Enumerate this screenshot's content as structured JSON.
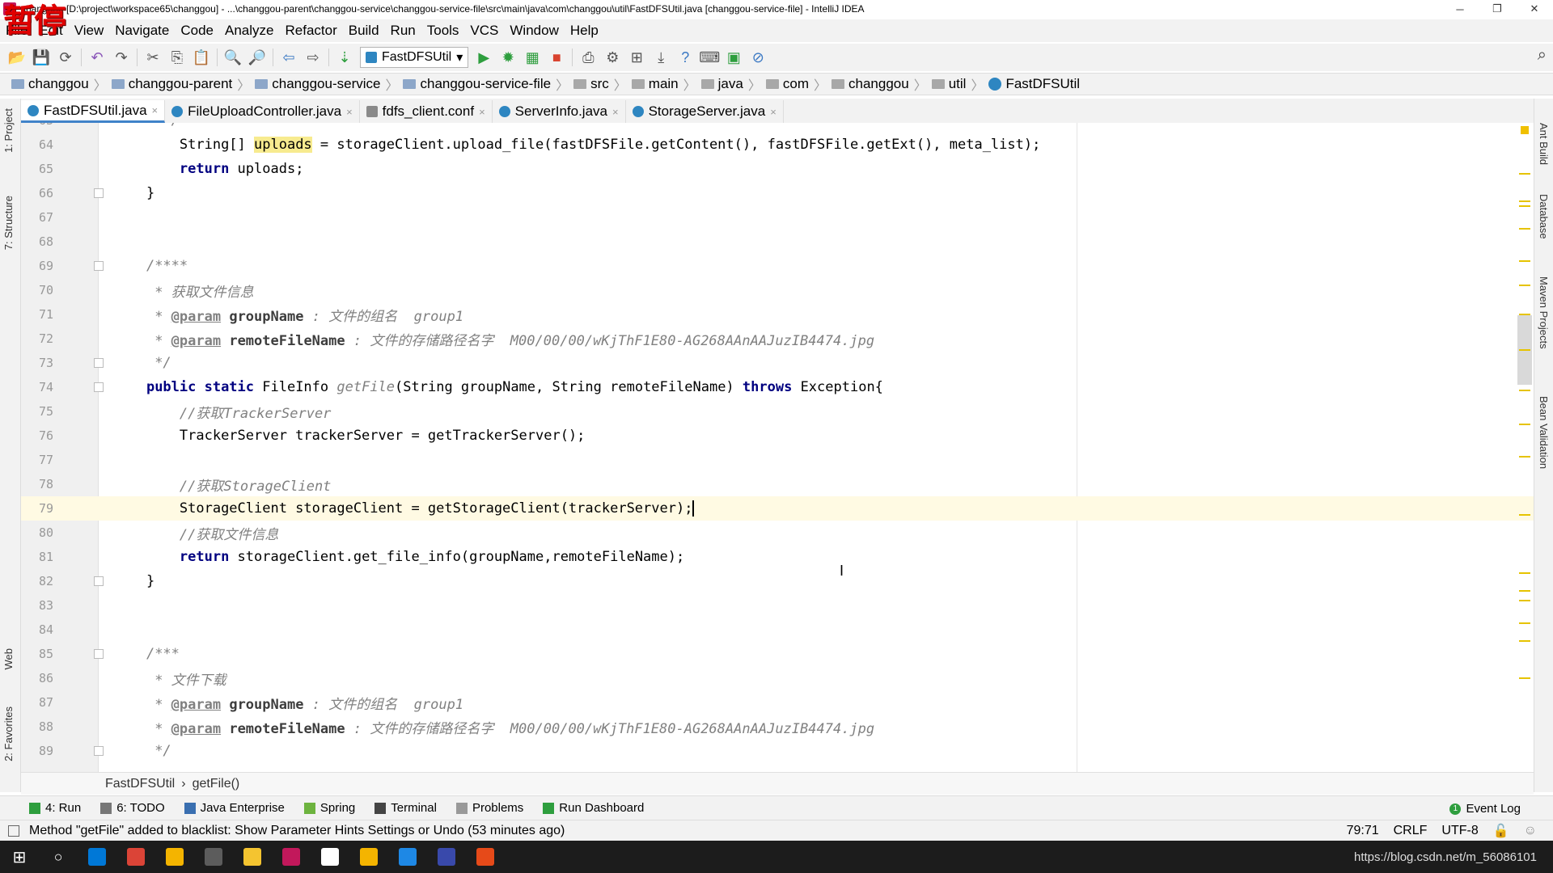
{
  "window": {
    "title": "changgou [D:\\project\\workspace65\\changgou] - ...\\changgou-parent\\changgou-service\\changgou-service-file\\src\\main\\java\\com\\changgou\\util\\FastDFSUtil.java [changgou-service-file] - IntelliJ IDEA",
    "overlay_text": "暂停",
    "minimize": "─",
    "restore": "❐",
    "close": "✕"
  },
  "menu": [
    "File",
    "Edit",
    "View",
    "Navigate",
    "Code",
    "Analyze",
    "Refactor",
    "Build",
    "Run",
    "Tools",
    "VCS",
    "Window",
    "Help"
  ],
  "toolbar": {
    "run_config": "FastDFSUtil",
    "run_config_arrow": "▾"
  },
  "breadcrumbs": [
    "changgou",
    "changgou-parent",
    "changgou-service",
    "changgou-service-file",
    "src",
    "main",
    "java",
    "com",
    "changgou",
    "util",
    "FastDFSUtil"
  ],
  "crumb_sep": "〉",
  "left_tools": [
    "1: Project",
    "7: Structure",
    "Web",
    "2: Favorites"
  ],
  "right_tools": [
    "Ant Build",
    "Database",
    "Maven Projects",
    "Bean Validation"
  ],
  "tabs": [
    {
      "label": "FastDFSUtil.java",
      "active": true
    },
    {
      "label": "FileUploadController.java",
      "active": false
    },
    {
      "label": "fdfs_client.conf",
      "active": false
    },
    {
      "label": "ServerInfo.java",
      "active": false
    },
    {
      "label": "StorageServer.java",
      "active": false
    }
  ],
  "tab_close": "×",
  "editor": {
    "lines": [
      {
        "n": "63",
        "indent": "      ",
        "parts": [
          {
            "t": "*/",
            "c": "cm"
          }
        ]
      },
      {
        "n": "64",
        "indent": "        ",
        "parts": [
          {
            "t": "String[] ",
            "c": ""
          },
          {
            "t": "uploads",
            "c": "hl"
          },
          {
            "t": " = storageClient.upload_file(fastDFSFile.getContent(), fastDFSFile.getExt(), meta_list);",
            "c": ""
          }
        ]
      },
      {
        "n": "65",
        "indent": "        ",
        "parts": [
          {
            "t": "return",
            "c": "kw"
          },
          {
            "t": " uploads;",
            "c": ""
          }
        ]
      },
      {
        "n": "66",
        "indent": "    ",
        "parts": [
          {
            "t": "}",
            "c": ""
          }
        ]
      },
      {
        "n": "67",
        "indent": "",
        "parts": []
      },
      {
        "n": "68",
        "indent": "",
        "parts": []
      },
      {
        "n": "69",
        "indent": "    ",
        "parts": [
          {
            "t": "/****",
            "c": "cm"
          }
        ]
      },
      {
        "n": "70",
        "indent": "     ",
        "parts": [
          {
            "t": "* 获取文件信息",
            "c": "cm"
          }
        ]
      },
      {
        "n": "71",
        "indent": "     ",
        "parts": [
          {
            "t": "* ",
            "c": "cm"
          },
          {
            "t": "@param",
            "c": "cmtag"
          },
          {
            "t": " groupName",
            "c": "cmparam"
          },
          {
            "t": " : 文件的组名  group1",
            "c": "cm"
          }
        ]
      },
      {
        "n": "72",
        "indent": "     ",
        "parts": [
          {
            "t": "* ",
            "c": "cm"
          },
          {
            "t": "@param",
            "c": "cmtag"
          },
          {
            "t": " remoteFileName",
            "c": "cmparam"
          },
          {
            "t": " : 文件的存储路径名字  M00/00/00/wKjThF1E80-AG268AAnAAJuzIB4474.jpg",
            "c": "cm"
          }
        ]
      },
      {
        "n": "73",
        "indent": "     ",
        "parts": [
          {
            "t": "*/",
            "c": "cm"
          }
        ]
      },
      {
        "n": "74",
        "indent": "    ",
        "parts": [
          {
            "t": "public static",
            "c": "kw"
          },
          {
            "t": " FileInfo ",
            "c": ""
          },
          {
            "t": "getFile",
            "c": "cm"
          },
          {
            "t": "(String groupName, String remoteFileName) ",
            "c": ""
          },
          {
            "t": "throws",
            "c": "kw"
          },
          {
            "t": " Exception{",
            "c": ""
          }
        ]
      },
      {
        "n": "75",
        "indent": "        ",
        "parts": [
          {
            "t": "//获取TrackerServer",
            "c": "cm"
          }
        ]
      },
      {
        "n": "76",
        "indent": "        ",
        "parts": [
          {
            "t": "TrackerServer trackerServer = getTrackerServer();",
            "c": ""
          }
        ]
      },
      {
        "n": "77",
        "indent": "",
        "parts": []
      },
      {
        "n": "78",
        "indent": "        ",
        "parts": [
          {
            "t": "//获取StorageClient",
            "c": "cm"
          }
        ]
      },
      {
        "n": "79",
        "indent": "        ",
        "parts": [
          {
            "t": "StorageClient storageClient = getStorageClient(trackerServer);",
            "c": ""
          }
        ],
        "current": true
      },
      {
        "n": "80",
        "indent": "        ",
        "parts": [
          {
            "t": "//获取文件信息",
            "c": "cm"
          }
        ]
      },
      {
        "n": "81",
        "indent": "        ",
        "parts": [
          {
            "t": "return",
            "c": "kw"
          },
          {
            "t": " storageClient.get_file_info(groupName,remoteFileName);",
            "c": ""
          }
        ]
      },
      {
        "n": "82",
        "indent": "    ",
        "parts": [
          {
            "t": "}",
            "c": ""
          }
        ]
      },
      {
        "n": "83",
        "indent": "",
        "parts": []
      },
      {
        "n": "84",
        "indent": "",
        "parts": []
      },
      {
        "n": "85",
        "indent": "    ",
        "parts": [
          {
            "t": "/***",
            "c": "cm"
          }
        ]
      },
      {
        "n": "86",
        "indent": "     ",
        "parts": [
          {
            "t": "* 文件下载",
            "c": "cm"
          }
        ]
      },
      {
        "n": "87",
        "indent": "     ",
        "parts": [
          {
            "t": "* ",
            "c": "cm"
          },
          {
            "t": "@param",
            "c": "cmtag"
          },
          {
            "t": " groupName",
            "c": "cmparam"
          },
          {
            "t": " : 文件的组名  group1",
            "c": "cm"
          }
        ]
      },
      {
        "n": "88",
        "indent": "     ",
        "parts": [
          {
            "t": "* ",
            "c": "cm"
          },
          {
            "t": "@param",
            "c": "cmtag"
          },
          {
            "t": " remoteFileName",
            "c": "cmparam"
          },
          {
            "t": " : 文件的存储路径名字  M00/00/00/wKjThF1E80-AG268AAnAAJuzIB4474.jpg",
            "c": "cm"
          }
        ]
      },
      {
        "n": "89",
        "indent": "     ",
        "parts": [
          {
            "t": "*/",
            "c": "cm"
          }
        ]
      }
    ]
  },
  "editor_breadcrumb": {
    "cls": "FastDFSUtil",
    "sep": "›",
    "method": "getFile()"
  },
  "tool_windows": [
    {
      "label": "4: Run",
      "color": "#2e9e3e"
    },
    {
      "label": "6: TODO",
      "color": "#777777"
    },
    {
      "label": "Java Enterprise",
      "color": "#3a6fb0"
    },
    {
      "label": "Spring",
      "color": "#6db33f"
    },
    {
      "label": "Terminal",
      "color": "#444444"
    },
    {
      "label": "Problems",
      "color": "#999999"
    },
    {
      "label": "Run Dashboard",
      "color": "#2e9e3e"
    }
  ],
  "event_log": "Event Log",
  "event_log_count": "1",
  "status": {
    "message": "Method \"getFile\" added to blacklist: Show Parameter Hints Settings or Undo (53 minutes ago)",
    "position": "79:71",
    "line_sep": "CRLF",
    "encoding": "UTF-8"
  },
  "taskbar": {
    "apps": [
      "#0078d7",
      "#db4437",
      "#f4b400",
      "#5c5c5c",
      "#f4c430",
      "#c2185b",
      "#ffffff",
      "#f4b400",
      "#1e88e5",
      "#3949ab",
      "#e64a19"
    ],
    "watermark": "https://blog.csdn.net/m_56086101"
  },
  "colors": {
    "keyword": "#000080",
    "comment": "#808080",
    "current_line": "#fffae3",
    "highlight": "#f7eb8f",
    "accent": "#4083c9"
  }
}
